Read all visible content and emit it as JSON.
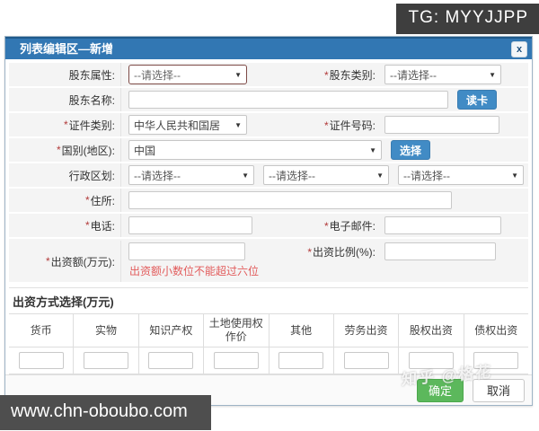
{
  "page": {
    "tg_badge": "TG: MYYJJPP",
    "site_badge": "www.chn-oboubo.com",
    "watermark": "知乎 @格花"
  },
  "icons": {
    "dropdown_arrow": "▼",
    "close": "x"
  },
  "dialog": {
    "title": "列表编辑区—新增"
  },
  "form": {
    "shareholder_attr": {
      "label": "股东属性:",
      "value": "--请选择--"
    },
    "shareholder_type": {
      "req": "*",
      "label": "股东类别:",
      "value": "--请选择--"
    },
    "shareholder_name": {
      "label": "股东名称:"
    },
    "read_card_button": "读卡",
    "cert_type": {
      "req": "*",
      "label": "证件类别:",
      "value": "中华人民共和国居"
    },
    "cert_no": {
      "req": "*",
      "label": "证件号码:"
    },
    "country": {
      "req": "*",
      "label": "国别(地区):",
      "value": "中国"
    },
    "choose_button": "选择",
    "admin_division": {
      "label": "行政区划:",
      "value1": "--请选择--",
      "value2": "--请选择--",
      "value3": "--请选择--"
    },
    "address": {
      "req": "*",
      "label": "住所:"
    },
    "phone": {
      "req": "*",
      "label": "电话:"
    },
    "email": {
      "req": "*",
      "label": "电子邮件:"
    },
    "amount": {
      "req": "*",
      "label": "出资额(万元):",
      "hint": "出资额小数位不能超过六位"
    },
    "ratio": {
      "req": "*",
      "label": "出资比例(%):"
    }
  },
  "capital_section": {
    "title": "出资方式选择(万元)",
    "columns": [
      "货币",
      "实物",
      "知识产权",
      "土地使用权作价",
      "其他",
      "劳务出资",
      "股权出资",
      "债权出资"
    ]
  },
  "footer": {
    "ok": "确定",
    "cancel": "取消"
  }
}
